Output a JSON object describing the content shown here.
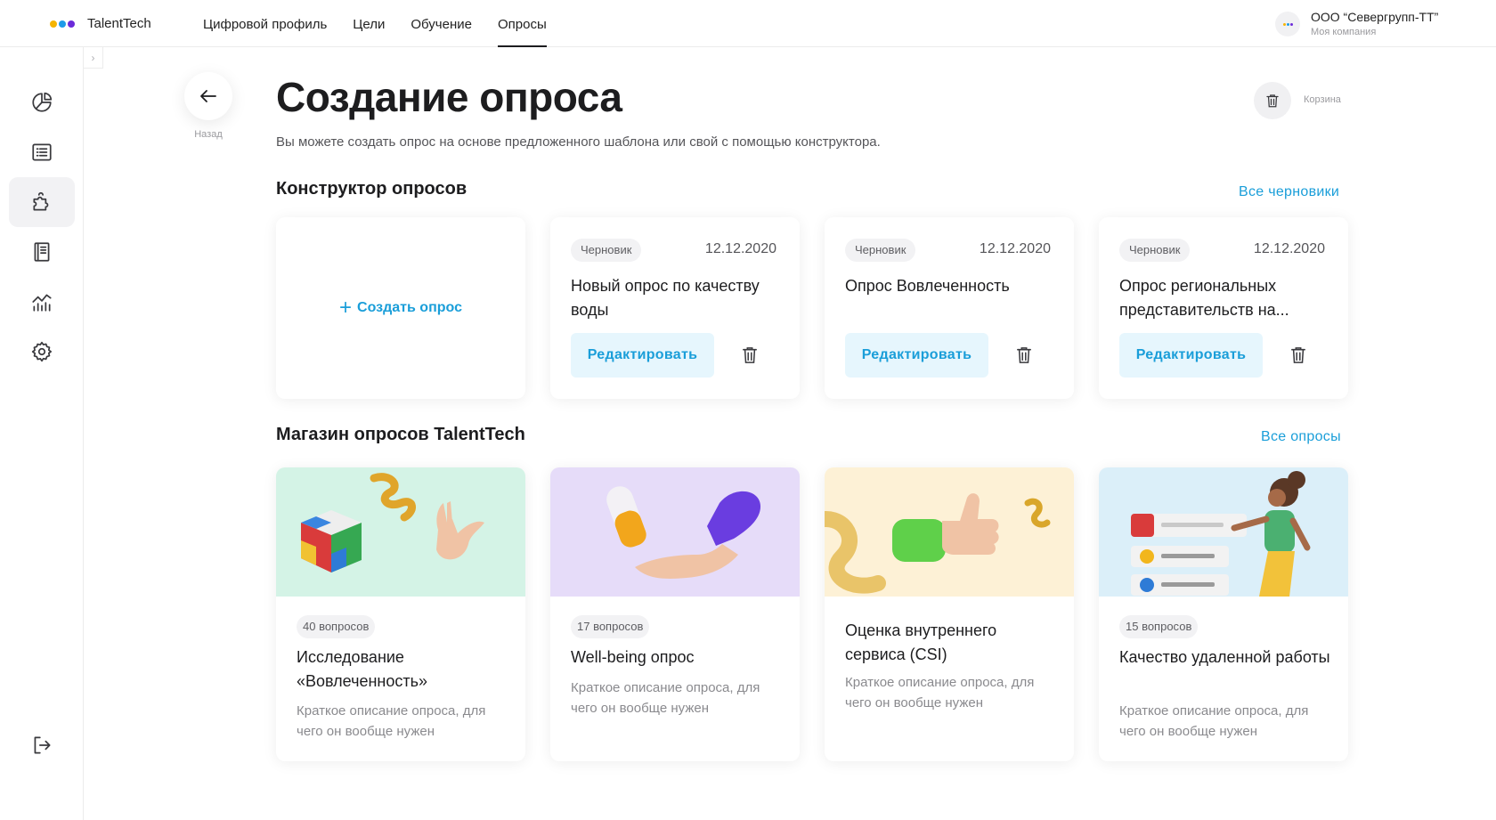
{
  "app": {
    "name": "TalentTech",
    "logo_colors": [
      "#f5b400",
      "#1e9be8",
      "#6b2bd9"
    ]
  },
  "nav": {
    "items": [
      {
        "label": "Цифровой профиль",
        "active": false
      },
      {
        "label": "Цели",
        "active": false
      },
      {
        "label": "Обучение",
        "active": false
      },
      {
        "label": "Опросы",
        "active": true
      }
    ]
  },
  "company": {
    "name": "ООО “Севергрупп-ТТ”",
    "subtitle": "Моя компания"
  },
  "sidebar": {
    "items": [
      {
        "icon": "pie-chart-icon",
        "active": false
      },
      {
        "icon": "list-icon",
        "active": false
      },
      {
        "icon": "puzzle-icon",
        "active": true
      },
      {
        "icon": "book-icon",
        "active": false
      },
      {
        "icon": "analytics-icon",
        "active": false
      },
      {
        "icon": "gear-icon",
        "active": false
      }
    ],
    "bottom_icon": "logout-icon"
  },
  "header": {
    "back_label": "Назад",
    "title": "Создание опроса",
    "subtitle": "Вы можете создать опрос на основе предложенного шаблона или свой с помощью конструктора.",
    "trash_label": "Корзина"
  },
  "constructor": {
    "title": "Конструктор опросов",
    "all_link": "Все черновики",
    "create_label": "Создать опрос",
    "drafts": [
      {
        "badge": "Черновик",
        "date": "12.12.2020",
        "title": "Новый опрос по качеству воды",
        "edit_label": "Редактировать"
      },
      {
        "badge": "Черновик",
        "date": "12.12.2020",
        "title": "Опрос Вовлеченность",
        "edit_label": "Редактировать"
      },
      {
        "badge": "Черновик",
        "date": "12.12.2020",
        "title": "Опрос региональных представительств на...",
        "edit_label": "Редактировать"
      }
    ]
  },
  "store": {
    "title": "Магазин опросов TalentTech",
    "all_link": "Все опросы",
    "items": [
      {
        "badge": "40 вопросов",
        "title": "Исследование «Вовлеченность»",
        "description": "Краткое описание опроса, для чего он вообще нужен",
        "bg": "#d4f3e6"
      },
      {
        "badge": "17 вопросов",
        "title": "Well-being опрос",
        "description": "Краткое описание опроса, для чего он вообще нужен",
        "bg": "#e6dcf9"
      },
      {
        "badge": "",
        "title": "Оценка внутреннего сервиса (CSI)",
        "description": "Краткое описание опроса, для чего он вообще нужен",
        "bg": "#fdf1d6"
      },
      {
        "badge": "15 вопросов",
        "title": "Качество удаленной работы",
        "description": "Краткое описание опроса, для чего он вообще нужен",
        "bg": "#dbeff9"
      }
    ]
  }
}
